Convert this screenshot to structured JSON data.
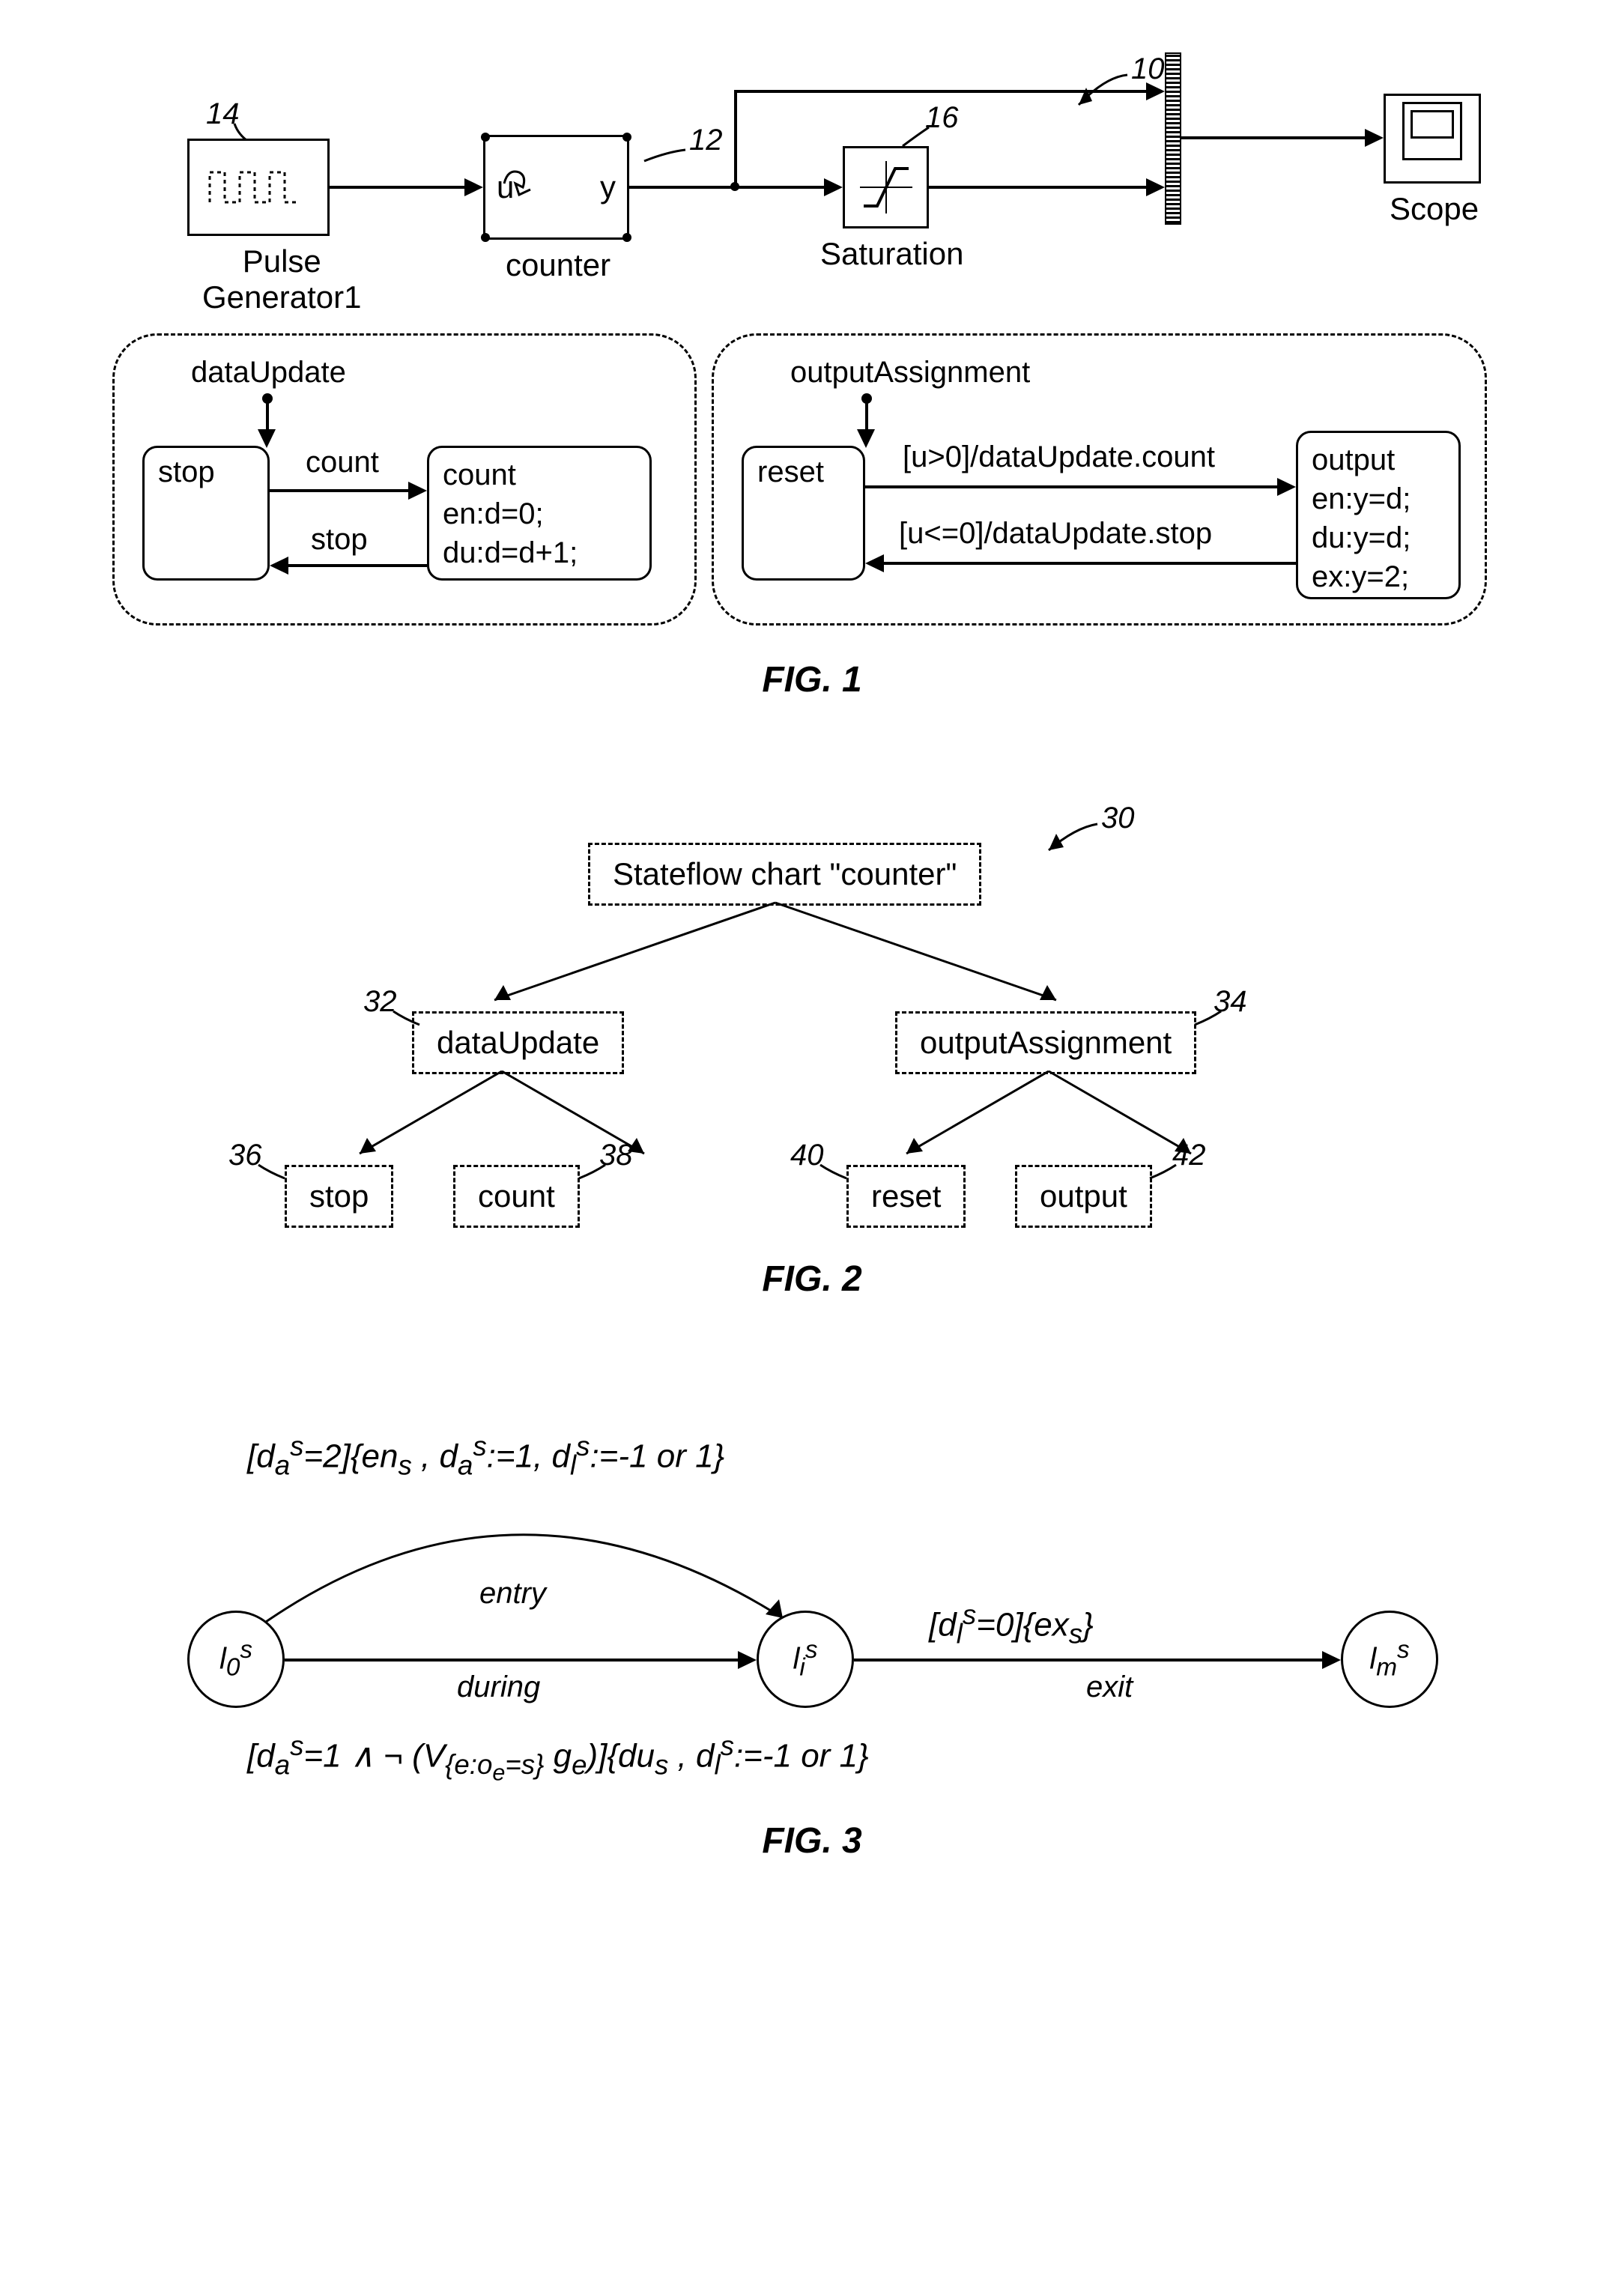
{
  "fig1": {
    "ref10": "10",
    "ref12": "12",
    "ref14": "14",
    "ref16": "16",
    "pulse_label": "Pulse\nGenerator1",
    "counter_label": "counter",
    "counter_u": "u",
    "counter_y": "y",
    "saturation_label": "Saturation",
    "scope_label": "Scope",
    "dataUpdate": "dataUpdate",
    "outputAssignment": "outputAssignment",
    "stop_state": "stop",
    "count_state_line1": "count",
    "count_state_line2": "en:d=0;",
    "count_state_line3": "du:d=d+1;",
    "count_trans": "count",
    "stop_trans": "stop",
    "reset_state": "reset",
    "output_state_line1": "output",
    "output_state_line2": "en:y=d;",
    "output_state_line3": "du:y=d;",
    "output_state_line4": "ex:y=2;",
    "trans_guard1": "[u>0]/dataUpdate.count",
    "trans_guard2": "[u<=0]/dataUpdate.stop",
    "caption": "FIG. 1"
  },
  "fig2": {
    "ref30": "30",
    "ref32": "32",
    "ref34": "34",
    "ref36": "36",
    "ref38": "38",
    "ref40": "40",
    "ref42": "42",
    "root": "Stateflow chart \"counter\"",
    "dataUpdate": "dataUpdate",
    "outputAssignment": "outputAssignment",
    "stop": "stop",
    "count": "count",
    "reset": "reset",
    "output": "output",
    "caption": "FIG. 2"
  },
  "fig3": {
    "formula_top": "[d<sub>a</sub><sup>s</sup>=2]{en<sub>s</sub> , d<sub>a</sub><sup>s</sup>:=1, d<sub>l</sub><sup>s</sup>:=-1 or 1}",
    "formula_bot": "[d<sub>a</sub><sup>s</sup>=1 ∧ ¬ (V<sub>{e:o<sub>e</sub>=s}</sub>  g<sub>e</sub>)]{du<sub>s</sub> , d<sub>l</sub><sup>s</sup>:=-1 or 1}",
    "formula_exit": "[d<sub>l</sub><sup>s</sup>=0]{ex<sub>s</sub>}",
    "entry": "entry",
    "during": "during",
    "exit": "exit",
    "l0": "l<sub>0</sub><sup>s</sup>",
    "li": "l<sub>i</sub><sup>s</sup>",
    "lm": "l<sub>m</sub><sup>s</sup>",
    "caption": "FIG. 3"
  }
}
